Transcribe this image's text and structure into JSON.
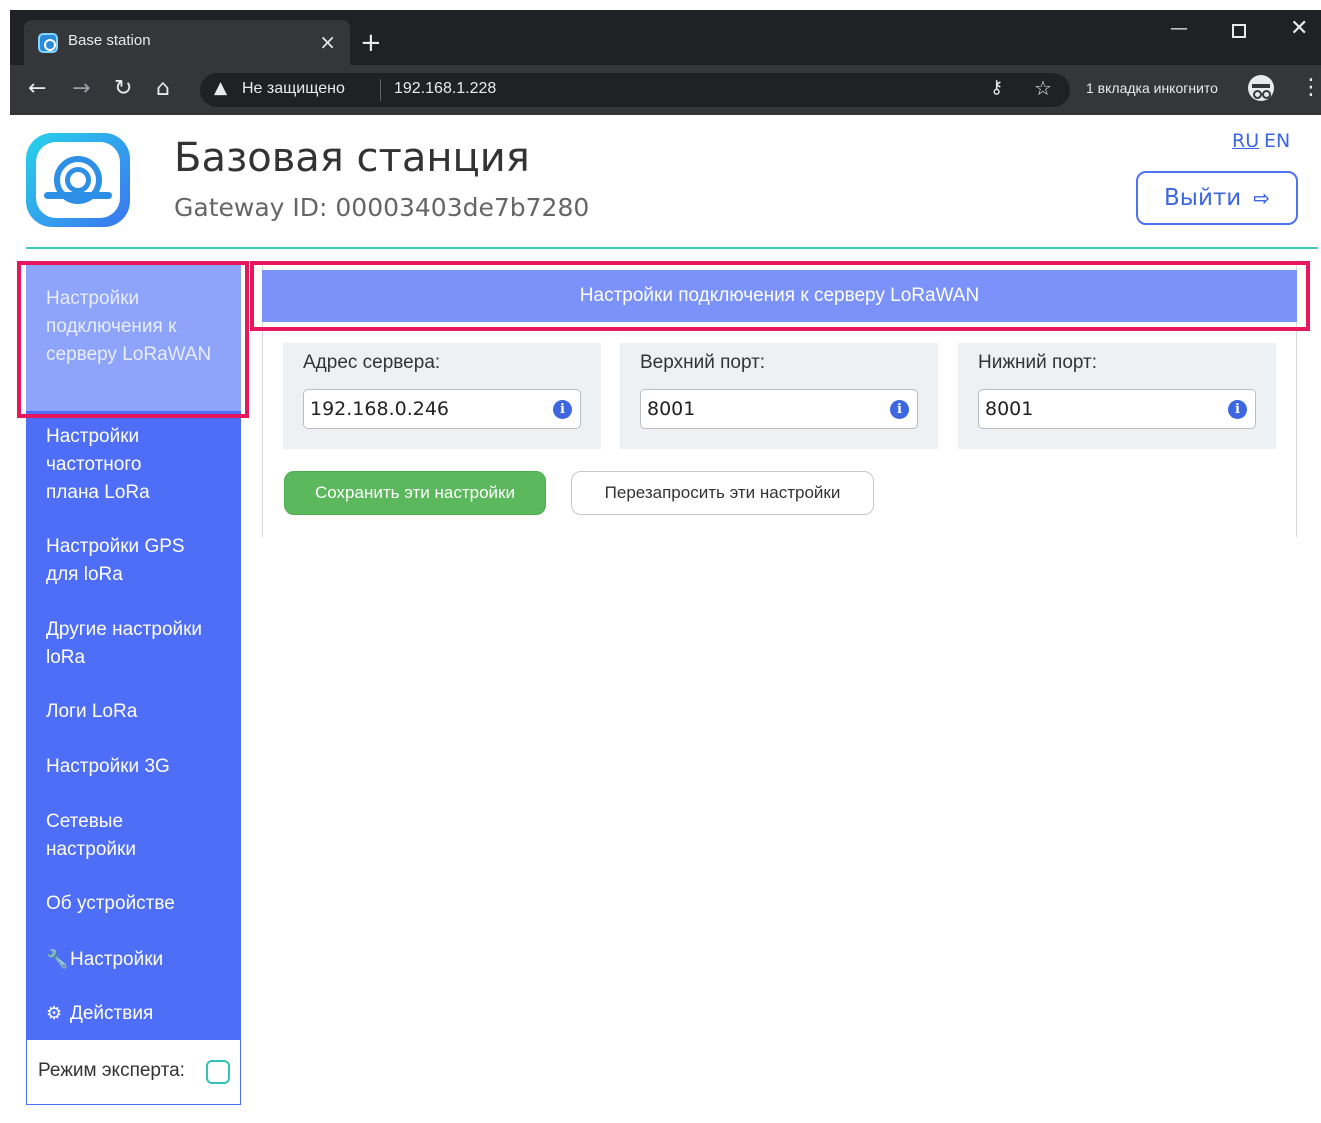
{
  "browser": {
    "tab_title": "Base station",
    "tab_close": "×",
    "new_tab": "+",
    "address_warning": "Не защищено",
    "url": "192.168.1.228",
    "incognito_label": "1 вкладка инкогнито"
  },
  "header": {
    "title": "Базовая станция",
    "gateway_id": "Gateway ID: 00003403de7b7280",
    "lang_ru": "RU",
    "lang_en": "EN",
    "logout_label": "Выйти"
  },
  "sidebar": {
    "items": [
      {
        "label": "Настройки подключения к серверу LoRaWAN",
        "active": true
      },
      {
        "label": "Настройки частотного плана LoRa"
      },
      {
        "label": "Настройки GPS для loRa"
      },
      {
        "label": "Другие настройки loRa"
      },
      {
        "label": "Логи LoRa"
      },
      {
        "label": "Настройки 3G"
      },
      {
        "label": "Сетевые настройки"
      },
      {
        "label": "Об устройстве"
      },
      {
        "label": "Настройки",
        "icon": "wrench-icon"
      },
      {
        "label": "Действия",
        "icon": "gear-icon"
      }
    ],
    "expert_label": "Режим эксперта:"
  },
  "main": {
    "panel_title": "Настройки подключения к серверу LoRaWAN",
    "fields": [
      {
        "label": "Адрес сервера:",
        "value": "192.168.0.246"
      },
      {
        "label": "Верхний порт:",
        "value": "8001"
      },
      {
        "label": "Нижний порт:",
        "value": "8001"
      }
    ],
    "save_label": "Сохранить эти настройки",
    "reload_label": "Перезапросить эти настройки"
  },
  "colors": {
    "sidebar_bg": "#4f6ef7",
    "sidebar_active": "#8ea3fa",
    "panel_header": "#7a92f9",
    "save_button": "#5cb85c",
    "highlight": "#e8175d",
    "divider": "#3fc6c0"
  }
}
